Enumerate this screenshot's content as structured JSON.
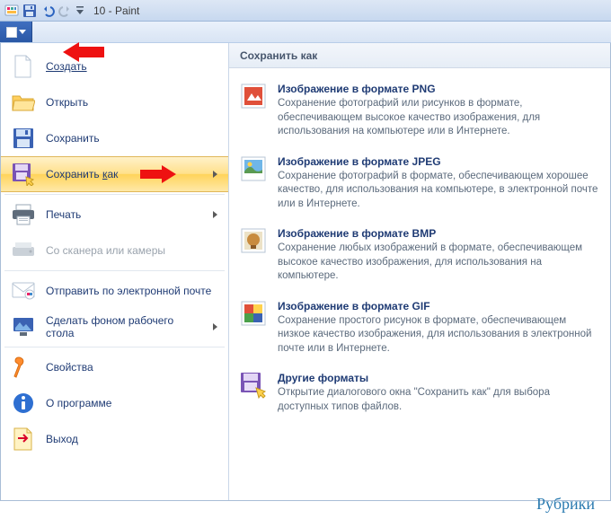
{
  "titlebar": {
    "title": "10 - Paint"
  },
  "right_pane": {
    "header": "Сохранить как"
  },
  "menu": {
    "new": "Создать",
    "open": "Открыть",
    "save": "Сохранить",
    "save_as": "Сохранить как",
    "print": "Печать",
    "scanner": "Со сканера или камеры",
    "email": "Отправить по электронной почте",
    "wallpaper": "Сделать фоном рабочего стола",
    "properties": "Свойства",
    "about": "О программе",
    "exit": "Выход"
  },
  "formats": {
    "png": {
      "title": "Изображение в формате PNG",
      "desc": "Сохранение фотографий или рисунков в формате, обеспечивающем высокое качество изображения, для использования на компьютере или в Интернете."
    },
    "jpeg": {
      "title": "Изображение в формате JPEG",
      "desc": "Сохранение фотографий в формате, обеспечивающем хорошее качество, для использования на компьютере, в электронной почте или в Интернете."
    },
    "bmp": {
      "title": "Изображение в формате BMP",
      "desc": "Сохранение любых изображений в формате, обеспечивающем высокое качество изображения, для использования на компьютере."
    },
    "gif": {
      "title": "Изображение в формате GIF",
      "desc": "Сохранение простого рисунок в формате, обеспечивающем низкое качество изображения, для использования в электронной почте или в Интернете."
    },
    "other": {
      "title": "Другие форматы",
      "desc": "Открытие диалогового окна \"Сохранить как\" для выбора доступных типов файлов."
    }
  },
  "footer": {
    "rubriki": "Рубрики"
  }
}
